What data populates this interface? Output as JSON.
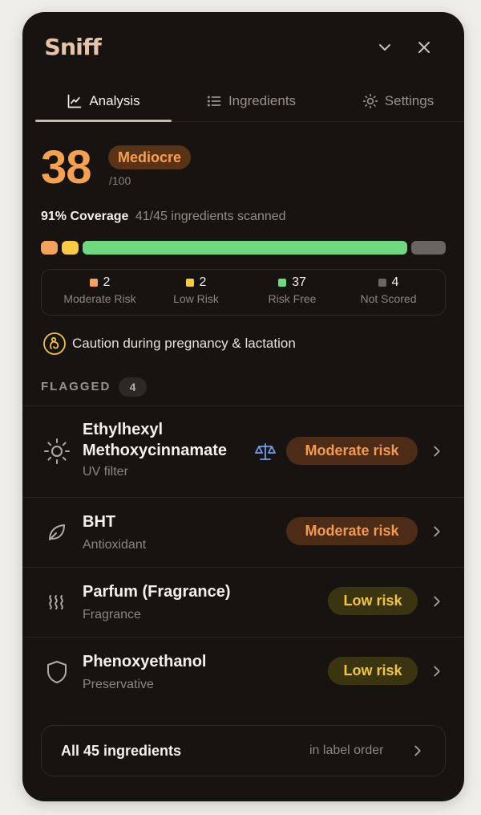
{
  "app": {
    "logo": "Sniff"
  },
  "header": {
    "collapse_icon": "chevron-down-icon",
    "close_icon": "close-icon"
  },
  "tabs": [
    {
      "label": "Analysis",
      "icon": "line-chart-icon",
      "active": true
    },
    {
      "label": "Ingredients",
      "icon": "list-icon",
      "active": false
    },
    {
      "label": "Settings",
      "icon": "sun-gear-icon",
      "active": false
    }
  ],
  "score": {
    "value": "38",
    "max": "/100",
    "rating": "Mediocre"
  },
  "coverage": {
    "label": "91% Coverage",
    "detail": "41/45 ingredients scanned"
  },
  "legend": [
    {
      "count": "2",
      "label": "Moderate Risk",
      "color": "#f5a35c"
    },
    {
      "count": "2",
      "label": "Low Risk",
      "color": "#f6cc45"
    },
    {
      "count": "37",
      "label": "Risk Free",
      "color": "#6fd880"
    },
    {
      "count": "4",
      "label": "Not Scored",
      "color": "#6b6561"
    }
  ],
  "caution": {
    "text": "Caution during pregnancy & lactation",
    "icon": "pregnancy-icon"
  },
  "flagged": {
    "label": "FLAGGED",
    "count": "4",
    "items": [
      {
        "name_line1": "Ethylhexyl",
        "name_line2": "Methoxycinnamate",
        "category": "UV filter",
        "risk": "Moderate risk",
        "icon": "sun-icon",
        "extra_icon": "scale-icon"
      },
      {
        "name": "BHT",
        "category": "Antioxidant",
        "risk": "Moderate risk",
        "icon": "leaf-icon"
      },
      {
        "name": "Parfum (Fragrance)",
        "category": "Fragrance",
        "risk": "Low risk",
        "icon": "waves-icon"
      },
      {
        "name": "Phenoxyethanol",
        "category": "Preservative",
        "risk": "Low risk",
        "icon": "shield-icon"
      }
    ]
  },
  "all_ingredients": {
    "label": "All 45 ingredients",
    "order": "in label order"
  }
}
